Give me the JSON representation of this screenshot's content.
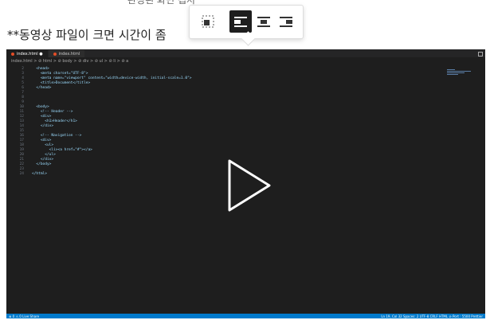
{
  "top_caption": "완성된 화면 캡처",
  "intro": "**동영상 파일이 크면 시간이 좀",
  "toolbar": {
    "items": [
      {
        "icon": "image-inline-icon"
      },
      {
        "icon": "align-left-icon",
        "active": true
      },
      {
        "icon": "align-center-icon"
      },
      {
        "icon": "align-right-icon"
      }
    ]
  },
  "video": {
    "tabs": [
      "index.html ●",
      "index.html"
    ],
    "breadcrumb": "index.html > ⊘ html > ⊘ body > ⊘ div > ⊘ ul > ⊘ li > ⊘ a",
    "code_lines": [
      "  <head>",
      "    <meta charset=\"UTF-8\">",
      "    <meta name=\"viewport\" content=\"width=device-width, initial-scale=1.0\">",
      "    <title>Document</title>",
      "  </head>",
      "",
      "",
      "",
      "  <body>",
      "    <!-- Header -->",
      "    <div>",
      "      <h1>Header</h1>",
      "    </div>",
      "",
      "    <!-- Navigation -->",
      "    <div>",
      "      <ul>",
      "        <li><a href=\"#\"></a>",
      "      </ul>",
      "    </div>",
      "  </body>",
      "",
      "</html>"
    ],
    "status_left": "⊗ 0 ⚠ 0   Live Share",
    "status_right": "Ln 19, Col 32   Spaces: 2   UTF-8   CRLF   HTML   ⊘ Port : 5500   Prettier"
  }
}
